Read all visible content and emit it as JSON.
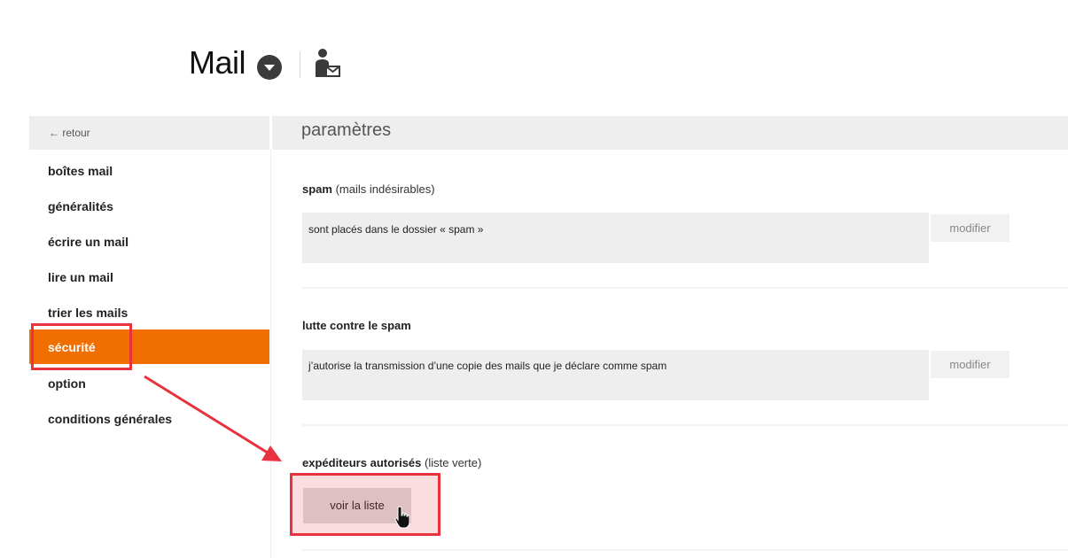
{
  "header": {
    "title": "Mail",
    "dropdown_icon": "chevron-down-circle-icon",
    "contact_icon": "contact-mail-icon"
  },
  "topbar": {
    "back_label": "← retour",
    "section_title": "paramètres"
  },
  "sidebar": {
    "items": [
      {
        "label": "boîtes mail"
      },
      {
        "label": "généralités"
      },
      {
        "label": "écrire un mail"
      },
      {
        "label": "lire un mail"
      },
      {
        "label": "trier les mails"
      },
      {
        "label": "sécurité",
        "active": true
      },
      {
        "label": "option"
      },
      {
        "label": "conditions générales"
      }
    ]
  },
  "settings": {
    "spam": {
      "title": "spam",
      "subtitle": "(mails indésirables)",
      "value": "sont placés dans le dossier « spam »",
      "action": "modifier"
    },
    "anti_spam": {
      "title": "lutte contre le spam",
      "value": "j’autorise la transmission d’une copie des mails que je déclare comme spam",
      "action": "modifier"
    },
    "whitelist": {
      "title": "expéditeurs autorisés",
      "subtitle": "(liste verte)",
      "action": "voir la liste"
    }
  },
  "colors": {
    "accent": "#f16e00",
    "highlight": "#e8333f",
    "panel": "#eeeeee"
  }
}
